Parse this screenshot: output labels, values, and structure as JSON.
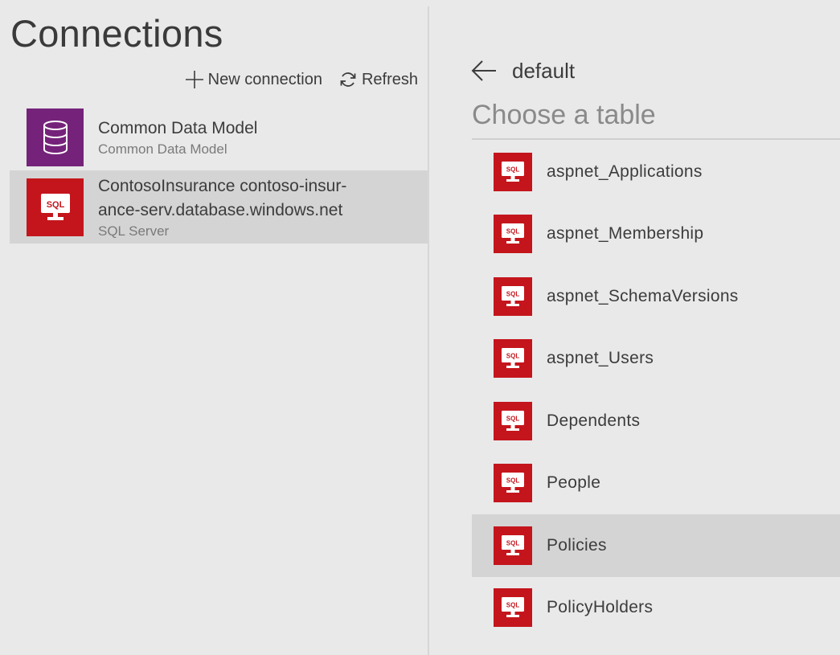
{
  "connections_panel": {
    "title": "Connections",
    "new_connection_label": "New connection",
    "refresh_label": "Refresh",
    "items": [
      {
        "name": "Common Data Model",
        "subtitle": "Common Data Model",
        "icon": "database-icon",
        "color": "#75237a"
      },
      {
        "name_line1": "ContosoInsurance contoso-insur-",
        "name_line2": "ance-serv.database.windows.net",
        "subtitle": "SQL Server",
        "icon": "sql-icon",
        "color": "#c4151c",
        "selected": true
      }
    ]
  },
  "tables_panel": {
    "database": "default",
    "heading": "Choose a table",
    "tables": [
      {
        "label": "aspnet_Applications"
      },
      {
        "label": "aspnet_Membership"
      },
      {
        "label": "aspnet_SchemaVersions"
      },
      {
        "label": "aspnet_Users"
      },
      {
        "label": "Dependents"
      },
      {
        "label": "People"
      },
      {
        "label": "Policies",
        "selected": true
      },
      {
        "label": "PolicyHolders"
      }
    ],
    "icon_text": "SQL",
    "icon_color": "#c4151c"
  },
  "colors": {
    "background": "#e9e9e9",
    "selected_row": "#d4d4d4",
    "sql_red": "#c4151c",
    "cdm_purple": "#75237a"
  }
}
